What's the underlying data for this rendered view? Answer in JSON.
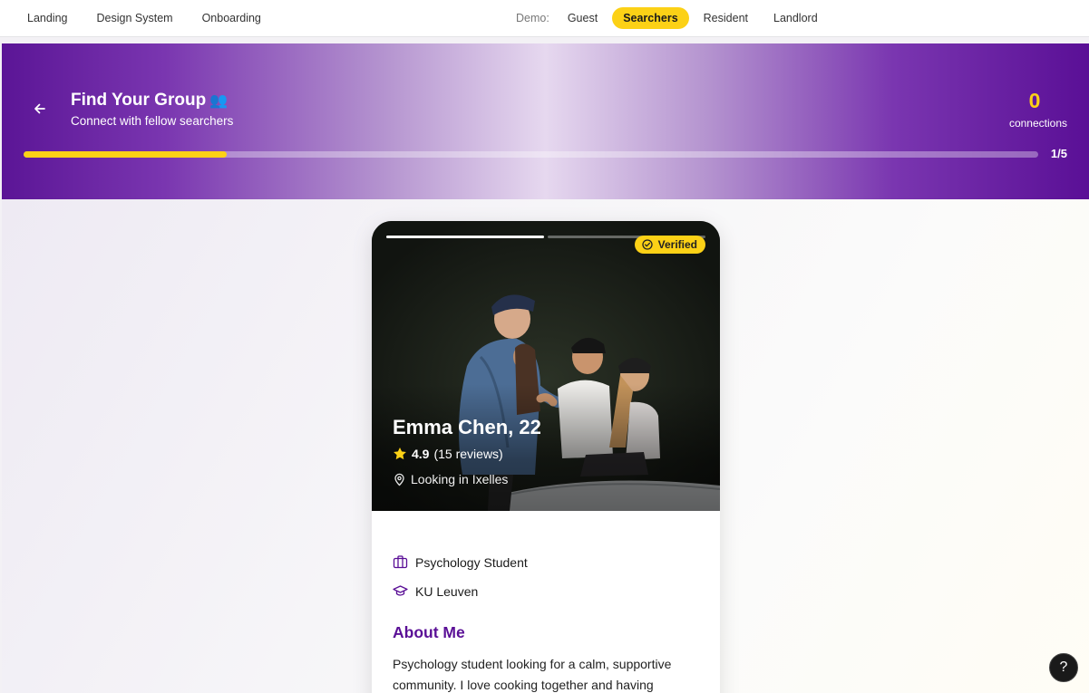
{
  "topnav": {
    "links": [
      "Landing",
      "Design System",
      "Onboarding"
    ],
    "demo_label": "Demo:",
    "demo_pills": [
      "Guest",
      "Searchers",
      "Resident",
      "Landlord"
    ],
    "active_demo": "Searchers"
  },
  "header": {
    "title": "Find Your Group",
    "title_emoji": "👥",
    "subtitle": "Connect with fellow searchers",
    "connections_count": "0",
    "connections_label": "connections",
    "progress_text": "1/5",
    "progress_fraction": 0.2
  },
  "profile": {
    "verified_label": "Verified",
    "name": "Emma Chen, 22",
    "rating": "4.9",
    "reviews": "(15 reviews)",
    "location": "Looking in Ixelles",
    "occupation": "Psychology Student",
    "university": "KU Leuven",
    "about_title": "About Me",
    "about_text": "Psychology student looking for a calm, supportive community. I love cooking together and having",
    "photo_count": 2,
    "active_photo": 0
  },
  "help": {
    "label": "?"
  },
  "colors": {
    "brand_purple": "#5a0f96",
    "accent_yellow": "#fcd116"
  },
  "icons": {
    "back": "arrow-left-icon",
    "verified": "check-circle-icon",
    "rating": "star-icon",
    "location": "map-pin-icon",
    "occupation": "briefcase-icon",
    "university": "graduation-cap-icon"
  }
}
